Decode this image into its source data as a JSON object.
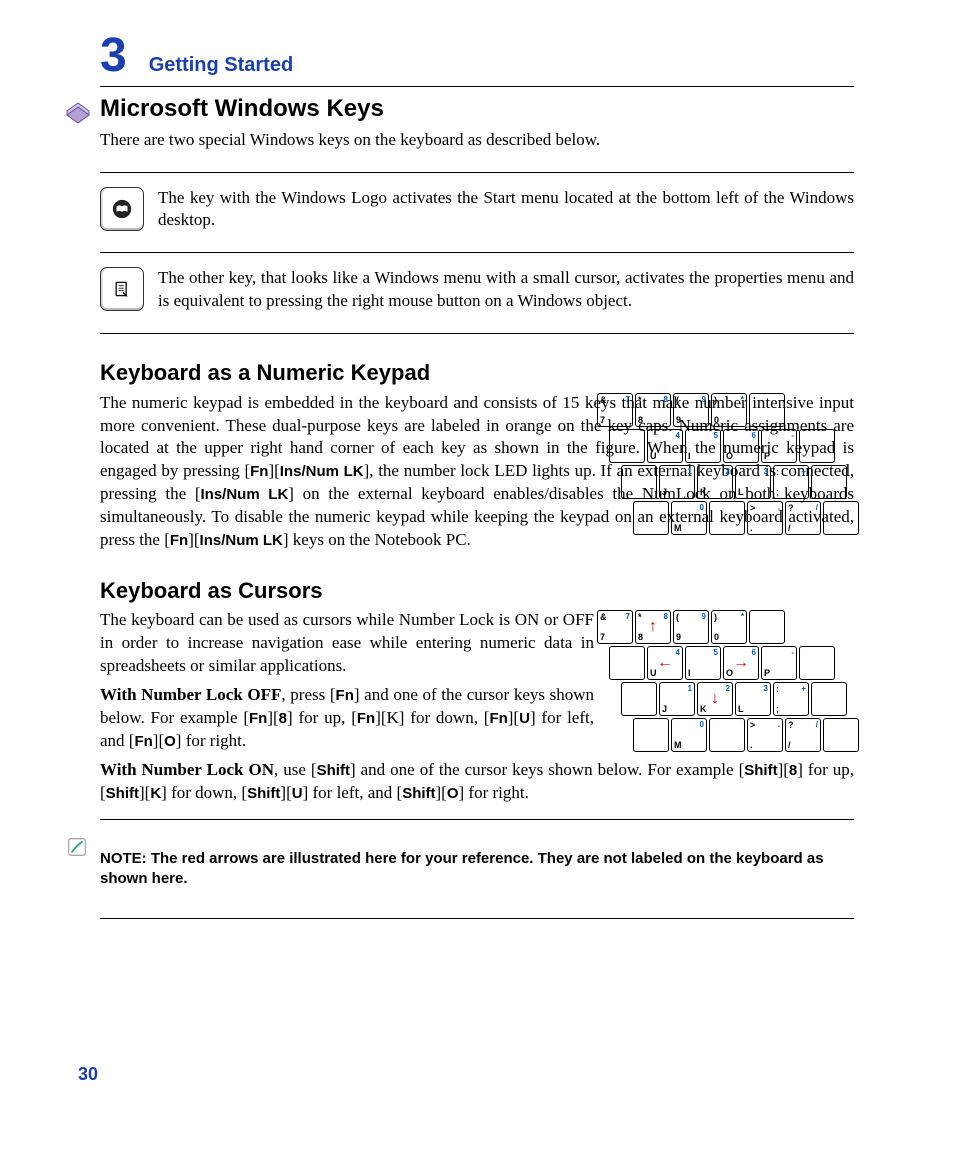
{
  "chapter": {
    "number": "3",
    "title": "Getting Started"
  },
  "page_number": "30",
  "section1": {
    "heading": "Microsoft Windows Keys",
    "intro": "There are two special Windows keys on the keyboard as described below.",
    "key1": "The key with the Windows Logo activates the Start menu located at the bottom left of the Windows desktop.",
    "key2": "The other key, that looks like a Windows menu with a small cursor, activates the properties menu and is equivalent to pressing the right mouse button on a Windows object."
  },
  "section2": {
    "heading": "Keyboard as a Numeric Keypad",
    "p1a": "The numeric keypad is embedded in the keyboard and consists of 15 keys that make number intensive input more convenient. These dual-purpose keys are labeled in orange on the key caps. Numeric assignments are located at the upper right hand corner of each key as shown in the figure. When the numeric keypad is engaged by pressing [",
    "fn1": "Fn",
    "p1b": "][",
    "ins1": "Ins/Num LK",
    "p1c": "], the number lock LED lights up. If an external keyboard is connected, pressing the [",
    "ins2": "Ins/Num LK",
    "p1d": "] on the external keyboard enables/disables the NumLock on both keyboards simultaneously. To disable the numeric keypad while keeping the keypad on an external keyboard activated, press the  [",
    "fn2": "Fn",
    "p1e": "][",
    "ins3": "Ins/Num LK",
    "p1f": "] keys on the Notebook PC."
  },
  "section3": {
    "heading": "Keyboard as Cursors",
    "p1": "The keyboard can be used as cursors while Number Lock is ON or OFF in order to increase navigation ease while entering numeric data in spreadsheets or similar applications.",
    "p2_lead": "With Number Lock OFF",
    "p2a": ", press [",
    "fn": "Fn",
    "p2b": "] and one of the cursor keys shown below. For example [",
    "p2c": "][",
    "eight": "8",
    "p2d": "] for up, [",
    "p2e": "][K] for down, [",
    "p2f": "][",
    "U": "U",
    "p2g": "] for left, and [",
    "p2h": "][",
    "O": "O",
    "p2i": "] for right.",
    "p3_lead": "With Number Lock ON",
    "p3a": ", use [",
    "shift": "Shift",
    "p3b": "] and one of the cursor keys shown below. For example [",
    "p3c": "][",
    "p3d": "] for up, [",
    "K": "K",
    "p3e": "] for down, [",
    "p3f": "] for left, and [",
    "p3g": "] for right."
  },
  "note": "NOTE: The red arrows are illustrated here for your reference. They are not labeled on the keyboard as shown here.",
  "keypad1": {
    "r1": [
      {
        "tl": "&",
        "bl": "7",
        "tr": "7"
      },
      {
        "tl": "*",
        "bl": "8",
        "tr": "8"
      },
      {
        "tl": "(",
        "bl": "9",
        "tr": "9"
      },
      {
        "tl": ")",
        "bl": "0",
        "tr": "*"
      },
      {}
    ],
    "r2": [
      {},
      {
        "bl": "U",
        "tr": "4"
      },
      {
        "bl": "I",
        "tr": "5"
      },
      {
        "bl": "O",
        "tr": "6"
      },
      {
        "bl": "P",
        "tr": "-"
      },
      {}
    ],
    "r3": [
      {},
      {
        "bl": "J",
        "tr": "1"
      },
      {
        "bl": "K",
        "tr": "2"
      },
      {
        "bl": "L",
        "tr": "3"
      },
      {
        "tl": ":",
        "bl": ";",
        "tr": "+"
      },
      {}
    ],
    "r4": [
      {},
      {
        "bl": "M",
        "tr": "0"
      },
      {},
      {
        "tl": ">",
        "bl": ".",
        "tr": "."
      },
      {
        "tl": "?",
        "bl": "/",
        "tr": "/"
      },
      {}
    ]
  },
  "keypad2": {
    "r1": [
      {
        "tl": "&",
        "bl": "7",
        "tr": "7"
      },
      {
        "tl": "*",
        "bl": "8",
        "tr": "8",
        "ar": "↑"
      },
      {
        "tl": "(",
        "bl": "9",
        "tr": "9"
      },
      {
        "tl": ")",
        "bl": "0",
        "tr": "*"
      },
      {}
    ],
    "r2": [
      {},
      {
        "bl": "U",
        "tr": "4",
        "ar": "←"
      },
      {
        "bl": "I",
        "tr": "5"
      },
      {
        "bl": "O",
        "tr": "6",
        "ar": "→"
      },
      {
        "bl": "P",
        "tr": "-"
      },
      {}
    ],
    "r3": [
      {},
      {
        "bl": "J",
        "tr": "1"
      },
      {
        "bl": "K",
        "tr": "2",
        "ar": "↓"
      },
      {
        "bl": "L",
        "tr": "3"
      },
      {
        "tl": ":",
        "bl": ";",
        "tr": "+"
      },
      {}
    ],
    "r4": [
      {},
      {
        "bl": "M",
        "tr": "0"
      },
      {},
      {
        "tl": ">",
        "bl": ".",
        "tr": "."
      },
      {
        "tl": "?",
        "bl": "/",
        "tr": "/"
      },
      {}
    ]
  }
}
